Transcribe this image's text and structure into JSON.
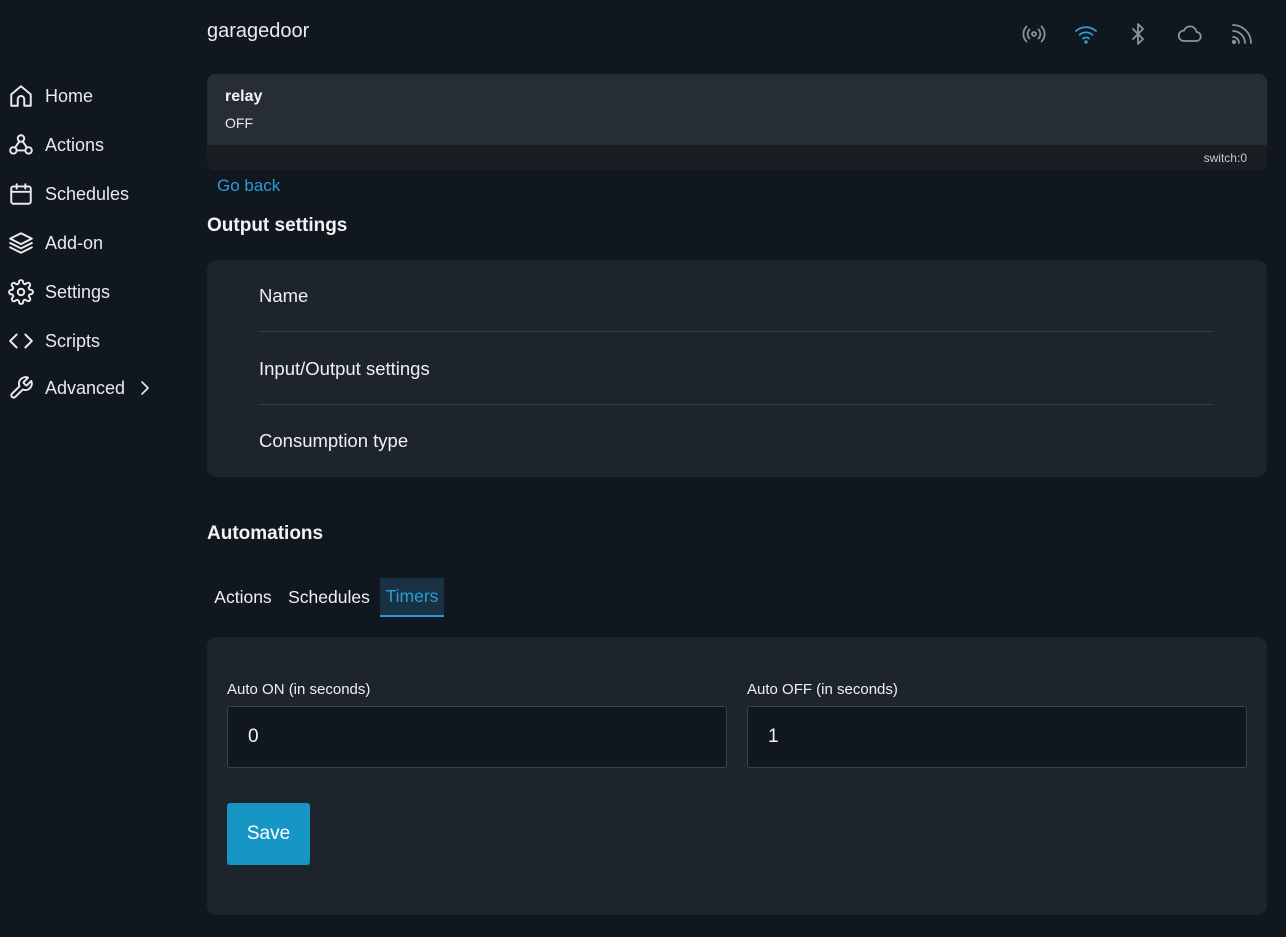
{
  "sidebar": {
    "items": [
      {
        "label": "Home",
        "icon": "home-icon"
      },
      {
        "label": "Actions",
        "icon": "webhook-icon"
      },
      {
        "label": "Schedules",
        "icon": "calendar-icon"
      },
      {
        "label": "Add-on",
        "icon": "layers-icon"
      },
      {
        "label": "Settings",
        "icon": "gear-icon"
      },
      {
        "label": "Scripts",
        "icon": "code-icon"
      },
      {
        "label": "Advanced",
        "icon": "wrench-icon"
      }
    ]
  },
  "header": {
    "device_name": "garagedoor",
    "status_icons": [
      "broadcast-icon",
      "wifi-icon",
      "bluetooth-icon",
      "cloud-icon",
      "rss-icon"
    ],
    "colors": {
      "wifi_active": "#2c9bd4",
      "inactive": "#8a929c"
    }
  },
  "relay": {
    "name": "relay",
    "state": "OFF",
    "id": "switch:0"
  },
  "go_back": "Go back",
  "output_settings": {
    "title": "Output settings",
    "rows": [
      "Name",
      "Input/Output settings",
      "Consumption type"
    ]
  },
  "automations": {
    "title": "Automations",
    "tabs": [
      {
        "label": "Actions",
        "active": false
      },
      {
        "label": "Schedules",
        "active": false
      },
      {
        "label": "Timers",
        "active": true
      }
    ],
    "auto_on": {
      "label": "Auto ON (in seconds)",
      "value": "0"
    },
    "auto_off": {
      "label": "Auto OFF (in seconds)",
      "value": "1"
    },
    "save_label": "Save"
  },
  "colors": {
    "accent": "#2c9bd4",
    "button": "#1696c5",
    "background": "#11171e",
    "card": "#1e242c"
  }
}
